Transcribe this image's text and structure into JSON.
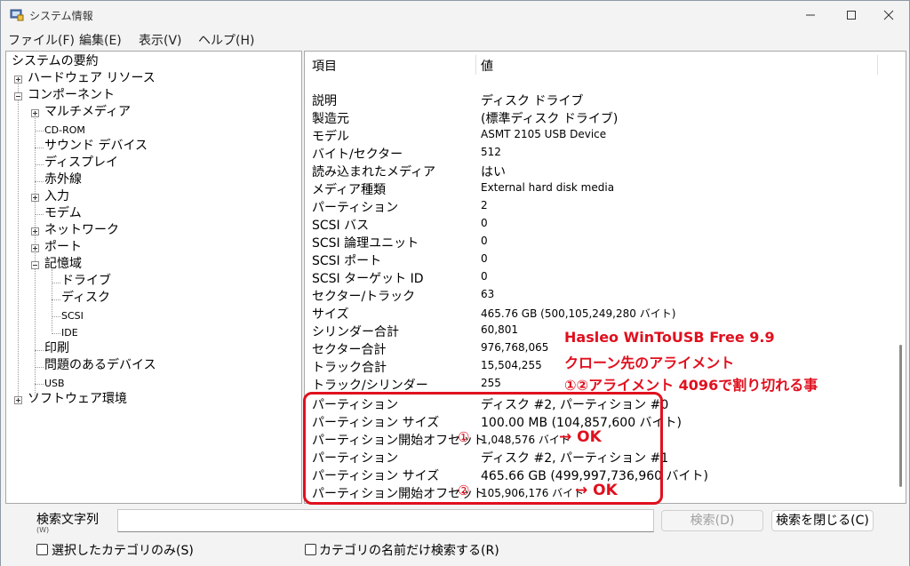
{
  "window": {
    "title": "システム情報"
  },
  "menu": [
    "ファイル(F)",
    "編集(E)",
    "表示(V)",
    "ヘルプ(H)"
  ],
  "tree": {
    "root": "システムの要約",
    "hardware": "ハードウェア リソース",
    "components": "コンポーネント",
    "multimedia": "マルチメディア",
    "cdrom": "CD-ROM",
    "sound": "サウンド デバイス",
    "display": "ディスプレイ",
    "infrared": "赤外線",
    "input": "入力",
    "modem": "モデム",
    "network": "ネットワーク",
    "ports": "ポート",
    "storage": "記憶域",
    "drives": "ドライブ",
    "disks": "ディスク",
    "scsi": "SCSI",
    "ide": "IDE",
    "printing": "印刷",
    "problem": "問題のあるデバイス",
    "usb": "USB",
    "software": "ソフトウェア環境"
  },
  "table": {
    "col_item": "項目",
    "col_value": "値",
    "rows": [
      {
        "k": "説明",
        "v": "ディスク ドライブ"
      },
      {
        "k": "製造元",
        "v": "(標準ディスク ドライブ)"
      },
      {
        "k": "モデル",
        "v": "ASMT 2105 USB Device"
      },
      {
        "k": "バイト/セクター",
        "v": "512"
      },
      {
        "k": "読み込まれたメディア",
        "v": "はい"
      },
      {
        "k": "メディア種類",
        "v": "External hard disk media"
      },
      {
        "k": "パーティション",
        "v": "2"
      },
      {
        "k": "SCSI バス",
        "v": "0"
      },
      {
        "k": "SCSI 論理ユニット",
        "v": "0"
      },
      {
        "k": "SCSI ポート",
        "v": "0"
      },
      {
        "k": "SCSI ターゲット ID",
        "v": "0"
      },
      {
        "k": "セクター/トラック",
        "v": "63"
      },
      {
        "k": "サイズ",
        "v": "465.76 GB (500,105,249,280 バイト)"
      },
      {
        "k": "シリンダー合計",
        "v": "60,801"
      },
      {
        "k": "セクター合計",
        "v": "976,768,065"
      },
      {
        "k": "トラック合計",
        "v": "15,504,255"
      },
      {
        "k": "トラック/シリンダー",
        "v": "255"
      },
      {
        "k": "パーティション",
        "v": "ディスク #2, パーティション #0"
      },
      {
        "k": "パーティション サイズ",
        "v": "100.00 MB (104,857,600 バイト)"
      },
      {
        "k": "パーティション開始オフセット",
        "v": "1,048,576 バイト"
      },
      {
        "k": "パーティション",
        "v": "ディスク #2, パーティション #1"
      },
      {
        "k": "パーティション サイズ",
        "v": "465.66 GB (499,997,736,960 バイト)"
      },
      {
        "k": "パーティション開始オフセット",
        "v": "105,906,176 バイト"
      }
    ],
    "mark1": "①",
    "mark2": "②",
    "ok1": "→ OK",
    "ok2": "→ OK"
  },
  "annotation": {
    "line1": "Hasleo WinToUSB Free 9.9",
    "line2": "クローン先のアライメント",
    "line3": "①②アライメント 4096で割り切れる事"
  },
  "search": {
    "label": "検索文字列",
    "label_sub": "(W)",
    "value": "",
    "find_button": "検索(D)",
    "close_button": "検索を閉じる(C)",
    "chk_selected": "選択したカテゴリのみ(S)",
    "chk_names": "カテゴリの名前だけ検索する(R)"
  },
  "colors": {
    "accent_red": "#e0101e"
  }
}
